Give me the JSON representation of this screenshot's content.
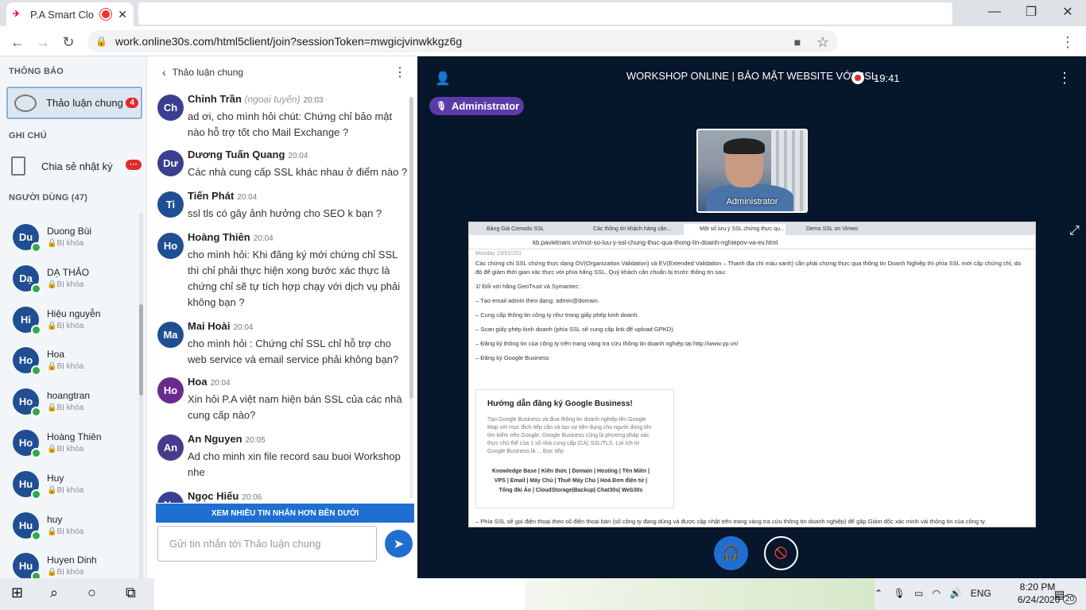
{
  "browser": {
    "tab_title": "P.A Smart Clo",
    "url": "work.online30s.com/html5client/join?sessionToken=mwgicjvinwkkgz6g"
  },
  "left_panel": {
    "notifications_heading": "THÔNG BÁO",
    "chat_item_label": "Thảo luận chung",
    "chat_item_badge": "4",
    "notes_heading": "GHI CHÚ",
    "notes_item_label": "Chia sẻ nhật ký",
    "notes_item_badge": "···",
    "users_heading": "NGƯỜI DÙNG (47)",
    "users": [
      {
        "initials": "Du",
        "name": "Duong Bùi",
        "status": "BỊ khóa"
      },
      {
        "initials": "Dạ",
        "name": "DẠ THẢO",
        "status": "BỊ khóa"
      },
      {
        "initials": "Hi",
        "name": "Hiệu nguyễn",
        "status": "BỊ khóa"
      },
      {
        "initials": "Ho",
        "name": "Hoa",
        "status": "BỊ khóa"
      },
      {
        "initials": "Ho",
        "name": "hoangtran",
        "status": "BỊ khóa"
      },
      {
        "initials": "Ho",
        "name": "Hoàng Thiên",
        "status": "BỊ khóa"
      },
      {
        "initials": "Hu",
        "name": "Huy",
        "status": "BỊ khóa"
      },
      {
        "initials": "Hu",
        "name": "huy",
        "status": "BỊ khóa"
      },
      {
        "initials": "Hu",
        "name": "Huyen Dinh",
        "status": "BỊ khóa"
      }
    ]
  },
  "chat": {
    "title": "Thảo luận chung",
    "messages": [
      {
        "initials": "Ch",
        "name": "Chinh Trần",
        "offline": "(ngoại tuyến)",
        "time": "20:03",
        "text": "ad ơi, cho mình hỏi chút: Chứng chỉ bảo mật nào hỗ trợ tốt cho Mail Exchange ?",
        "color": "#3b3f8f"
      },
      {
        "initials": "Dư",
        "name": "Dương Tuấn Quang",
        "offline": "",
        "time": "20:04",
        "text": "Các nhà cung cấp SSL khác nhau ở điểm nào ?",
        "color": "#3b3f8f"
      },
      {
        "initials": "Ti",
        "name": "Tiến Phát",
        "offline": "",
        "time": "20:04",
        "text": "ssl tls có gây ảnh hưởng cho SEO k bạn ?",
        "color": "#1f4f92"
      },
      {
        "initials": "Ho",
        "name": "Hoàng Thiên",
        "offline": "",
        "time": "20:04",
        "text": "cho mình hỏi: Khi đăng ký mới chứng chỉ SSL thì chỉ phải thực hiện xong bước xác thực là chứng chỉ sẽ tự tích hợp chạy với dịch vụ phải không bạn ?",
        "color": "#1f4f92"
      },
      {
        "initials": "Ma",
        "name": "Mai Hoài",
        "offline": "",
        "time": "20:04",
        "text": "cho mình hỏi : Chứng chỉ SSL chỉ hỗ trợ cho web service và email service phải không bạn?",
        "color": "#1f4f92"
      },
      {
        "initials": "Ho",
        "name": "Hoa",
        "offline": "",
        "time": "20:04",
        "text": "Xin hỏi P.A việt nam hiện bán SSL của các nhà cung cấp nào?",
        "color": "#6a2a8c"
      },
      {
        "initials": "An",
        "name": "An Nguyen",
        "offline": "",
        "time": "20:05",
        "text": "Ad cho minh xin file record sau buoi Workshop nhe",
        "color": "#4a3a8c"
      },
      {
        "initials": "Ng",
        "name": "Ngọc Hiếu",
        "offline": "",
        "time": "20:06",
        "text": "",
        "color": "#3b3f8f"
      }
    ],
    "more_button": "XEM NHIỀU TIN NHẮN HƠN BÊN DƯỚI",
    "input_placeholder": "Gửi tin nhắn tới Thảo luận chung"
  },
  "stage": {
    "title": "WORKSHOP ONLINE | BẢO MẬT WEBSITE VỚI SSL",
    "rec_time": "19:41",
    "presenter_badge": "Administrator",
    "webcam_label": "Administrator"
  },
  "shared_screen": {
    "tabs": [
      "Bảng Giá Comodo SSL",
      "Các thông tin khách hàng cần...",
      "Một số lưu ý SSL chứng thực qu...",
      "Demo SSL on Vimeo"
    ],
    "url": "kb.pavietnam.vn/mot-so-luu-y-ssl-chung-thuc-qua-thong-tin-doanh-nghiepov-va-ev.html",
    "date": "Monday 23/01/201",
    "paragraphs": [
      "Các chứng chỉ SSL chứng thực dạng OV(Organization Validation) và EV(Extended Validation – Thanh địa chỉ màu xanh) cần phải chứng thực qua thông tin Doanh Nghiệp thì phía SSL mới cấp chứng chỉ, do đó để giảm thời gian xác thực với phía hãng SSL, Quý khách cần chuẩn bị trước thông tin sau:",
      "1/ Đối với hãng GeoTrust và Symantec:",
      "– Tạo email admin theo dạng: admin@domain.",
      "– Cung cấp thông tin công ty như trong giấy phép kinh doanh.",
      "– Scan giấy phép kinh doanh (phía SSL sẽ cung cấp link để upload GPKD).",
      "– Đăng ký thông tin của công ty trên trang vàng tra cứu thông tin doanh nghiệp tại http://www.yp.vn/",
      "– Đăng ký Google Business"
    ],
    "card_title": "Hướng dẫn đăng ký Google Business!",
    "card_desc": "Tạo Google Business và đưa thông tin doanh nghiệp lên Google Map với mục đích tiếp cận và tạo sự tiện dụng cho người dùng khi tìm kiếm trên Google. Google Business cũng là phương pháp xác thực chủ thể của 1 số nhà cung cấp (CA) SSL/TLS. Lợi ích từ Google Business là ... Đọc tiếp",
    "card_links": "Knowledge Base | Kiến thức | Domain | Hosting | Tên Miền | VPS | Email | Máy Chủ | Thuê Máy Chủ | Hoá Đơn điện tử | Tổng đài Ảo | CloudStorage|Backup| Chat30s| Web30s",
    "footer": "– Phía SSL sẽ gọi điện thoại theo số điện thoại bàn (số công ty đang dùng và được cập nhật trên trang vàng tra cứu thông tin doanh nghiệp) để gặp Giám đốc xác minh vài thông tin của công ty."
  },
  "taskbar": {
    "lang": "ENG",
    "time": "8:20 PM",
    "date": "6/24/2020",
    "notif_count": "20"
  }
}
